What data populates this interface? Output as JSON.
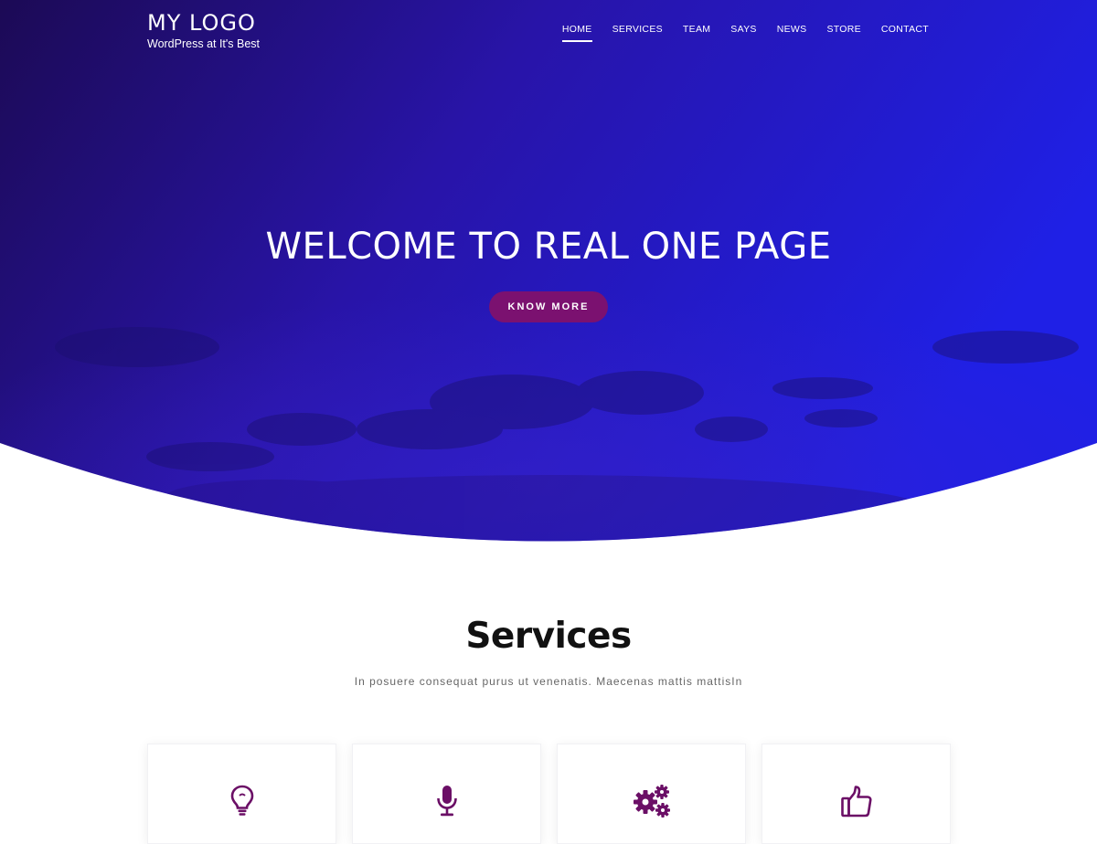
{
  "site": {
    "logo": "MY LOGO",
    "tagline": "WordPress at It's Best"
  },
  "nav": {
    "items": [
      {
        "label": "HOME",
        "active": true
      },
      {
        "label": "SERVICES",
        "active": false
      },
      {
        "label": "TEAM",
        "active": false
      },
      {
        "label": "SAYS",
        "active": false
      },
      {
        "label": "NEWS",
        "active": false
      },
      {
        "label": "STORE",
        "active": false
      },
      {
        "label": "CONTACT",
        "active": false
      }
    ]
  },
  "hero": {
    "title": "WELCOME TO REAL ONE PAGE",
    "cta_label": "KNOW MORE"
  },
  "services": {
    "heading": "Services",
    "subtitle": "In posuere consequat purus ut venenatis. Maecenas mattis mattisIn",
    "cards": [
      {
        "icon": "lightbulb-icon"
      },
      {
        "icon": "microphone-icon"
      },
      {
        "icon": "gears-icon"
      },
      {
        "icon": "thumbs-up-icon"
      }
    ]
  },
  "colors": {
    "hero_gradient_start": "#1f0b5e",
    "hero_gradient_mid": "#2a13b8",
    "hero_gradient_end": "#1e1de0",
    "accent": "#7b1170",
    "icon": "#6b0f66"
  }
}
